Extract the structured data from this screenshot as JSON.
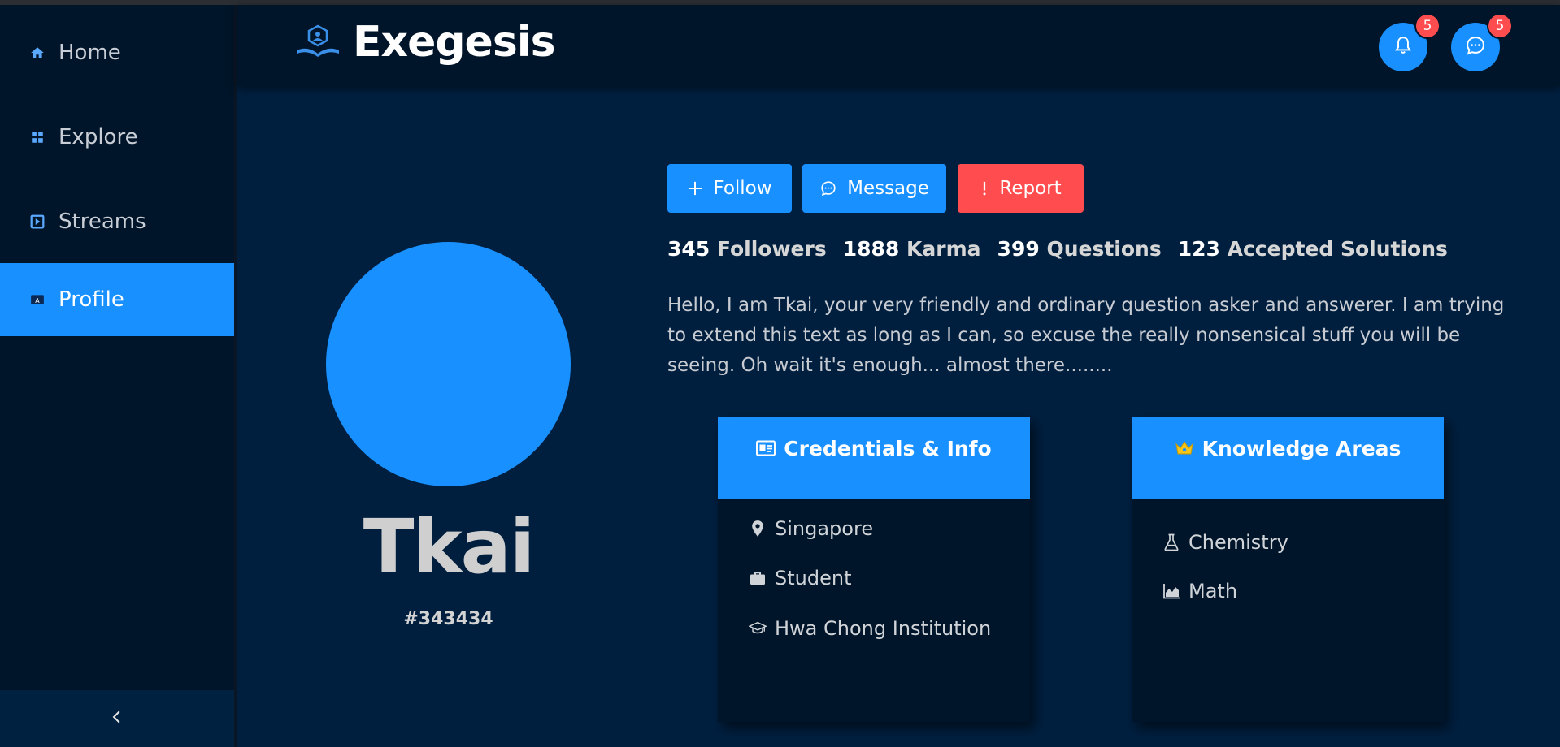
{
  "app": {
    "title": "Exegesis"
  },
  "sidebar": {
    "items": [
      {
        "label": "Home",
        "icon": "home-icon"
      },
      {
        "label": "Explore",
        "icon": "grid-icon"
      },
      {
        "label": "Streams",
        "icon": "play-square-icon"
      },
      {
        "label": "Profile",
        "icon": "id-card-icon",
        "active": true
      }
    ],
    "collapse_icon": "chevron-left-icon"
  },
  "header": {
    "notifications_count": "5",
    "messages_count": "5"
  },
  "profile": {
    "name": "Tkai",
    "tag": "#343434",
    "actions": {
      "follow": "Follow",
      "message": "Message",
      "report": "Report"
    },
    "stats": [
      {
        "value": "345",
        "label": "Followers"
      },
      {
        "value": "1888",
        "label": "Karma"
      },
      {
        "value": "399",
        "label": "Questions"
      },
      {
        "value": "123",
        "label": "Accepted Solutions"
      }
    ],
    "bio": "Hello, I am Tkai, your very friendly and ordinary question asker and answerer. I am trying to extend this text as long as I can, so excuse the really nonsensical stuff you will be seeing. Oh wait it's enough... almost there........"
  },
  "credentials": {
    "title": "Credentials & Info",
    "items": [
      {
        "icon": "location-pin-icon",
        "text": "Singapore"
      },
      {
        "icon": "briefcase-icon",
        "text": "Student"
      },
      {
        "icon": "graduation-cap-icon",
        "text": "Hwa Chong Institution"
      }
    ]
  },
  "knowledge": {
    "title": "Knowledge Areas",
    "items": [
      {
        "icon": "flask-icon",
        "text": "Chemistry"
      },
      {
        "icon": "area-chart-icon",
        "text": "Math"
      }
    ]
  },
  "colors": {
    "primary": "#1890ff",
    "danger": "#ff4d4f",
    "sidebar_bg": "#001529",
    "content_bg": "#001f3f",
    "crown": "#f5c518"
  }
}
